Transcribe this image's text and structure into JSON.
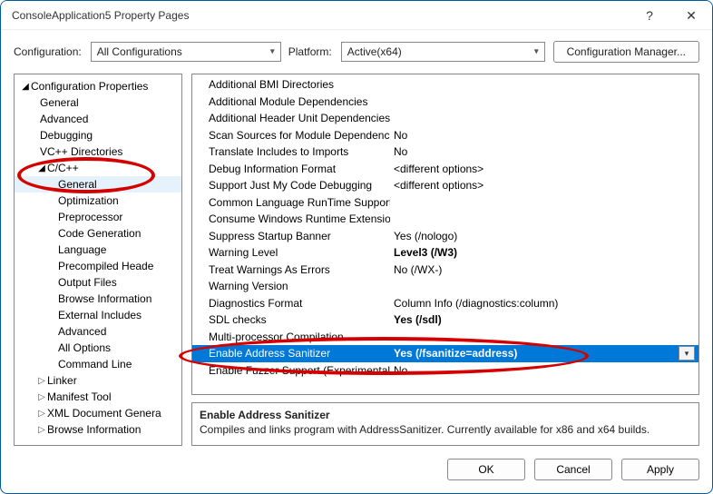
{
  "window": {
    "title": "ConsoleApplication5 Property Pages"
  },
  "toolbar": {
    "config_label": "Configuration:",
    "config_value": "All Configurations",
    "platform_label": "Platform:",
    "platform_value": "Active(x64)",
    "cfgmgr_label": "Configuration Manager..."
  },
  "tree": {
    "root": "Configuration Properties",
    "items1": [
      "General",
      "Advanced",
      "Debugging",
      "VC++ Directories"
    ],
    "ccpp": {
      "label": "C/C++",
      "children": [
        "General",
        "Optimization",
        "Preprocessor",
        "Code Generation",
        "Language",
        "Precompiled Heade",
        "Output Files",
        "Browse Information",
        "External Includes",
        "Advanced",
        "All Options",
        "Command Line"
      ]
    },
    "below": [
      "Linker",
      "Manifest Tool",
      "XML Document Genera",
      "Browse Information"
    ]
  },
  "grid": {
    "rows": [
      {
        "name": "Additional BMI Directories",
        "value": "",
        "bold": false
      },
      {
        "name": "Additional Module Dependencies",
        "value": "",
        "bold": false
      },
      {
        "name": "Additional Header Unit Dependencies",
        "value": "",
        "bold": false
      },
      {
        "name": "Scan Sources for Module Dependencies",
        "value": "No",
        "bold": false
      },
      {
        "name": "Translate Includes to Imports",
        "value": "No",
        "bold": false
      },
      {
        "name": "Debug Information Format",
        "value": "<different options>",
        "bold": false
      },
      {
        "name": "Support Just My Code Debugging",
        "value": "<different options>",
        "bold": false
      },
      {
        "name": "Common Language RunTime Support",
        "value": "",
        "bold": false
      },
      {
        "name": "Consume Windows Runtime Extension",
        "value": "",
        "bold": false
      },
      {
        "name": "Suppress Startup Banner",
        "value": "Yes (/nologo)",
        "bold": false
      },
      {
        "name": "Warning Level",
        "value": "Level3 (/W3)",
        "bold": true
      },
      {
        "name": "Treat Warnings As Errors",
        "value": "No (/WX-)",
        "bold": false
      },
      {
        "name": "Warning Version",
        "value": "",
        "bold": false
      },
      {
        "name": "Diagnostics Format",
        "value": "Column Info (/diagnostics:column)",
        "bold": false
      },
      {
        "name": "SDL checks",
        "value": "Yes (/sdl)",
        "bold": true
      },
      {
        "name": "Multi-processor Compilation",
        "value": "",
        "bold": false
      },
      {
        "name": "Enable Address Sanitizer",
        "value": "Yes (/fsanitize=address)",
        "bold": true,
        "selected": true,
        "dropdown": true
      },
      {
        "name": "Enable Fuzzer Support (Experimental)",
        "value": "No",
        "bold": false
      }
    ]
  },
  "desc": {
    "title": "Enable Address Sanitizer",
    "body": "Compiles and links program with AddressSanitizer. Currently available for x86 and x64 builds."
  },
  "footer": {
    "ok": "OK",
    "cancel": "Cancel",
    "apply": "Apply"
  },
  "titlebtns": {
    "help": "?",
    "close": "✕"
  }
}
